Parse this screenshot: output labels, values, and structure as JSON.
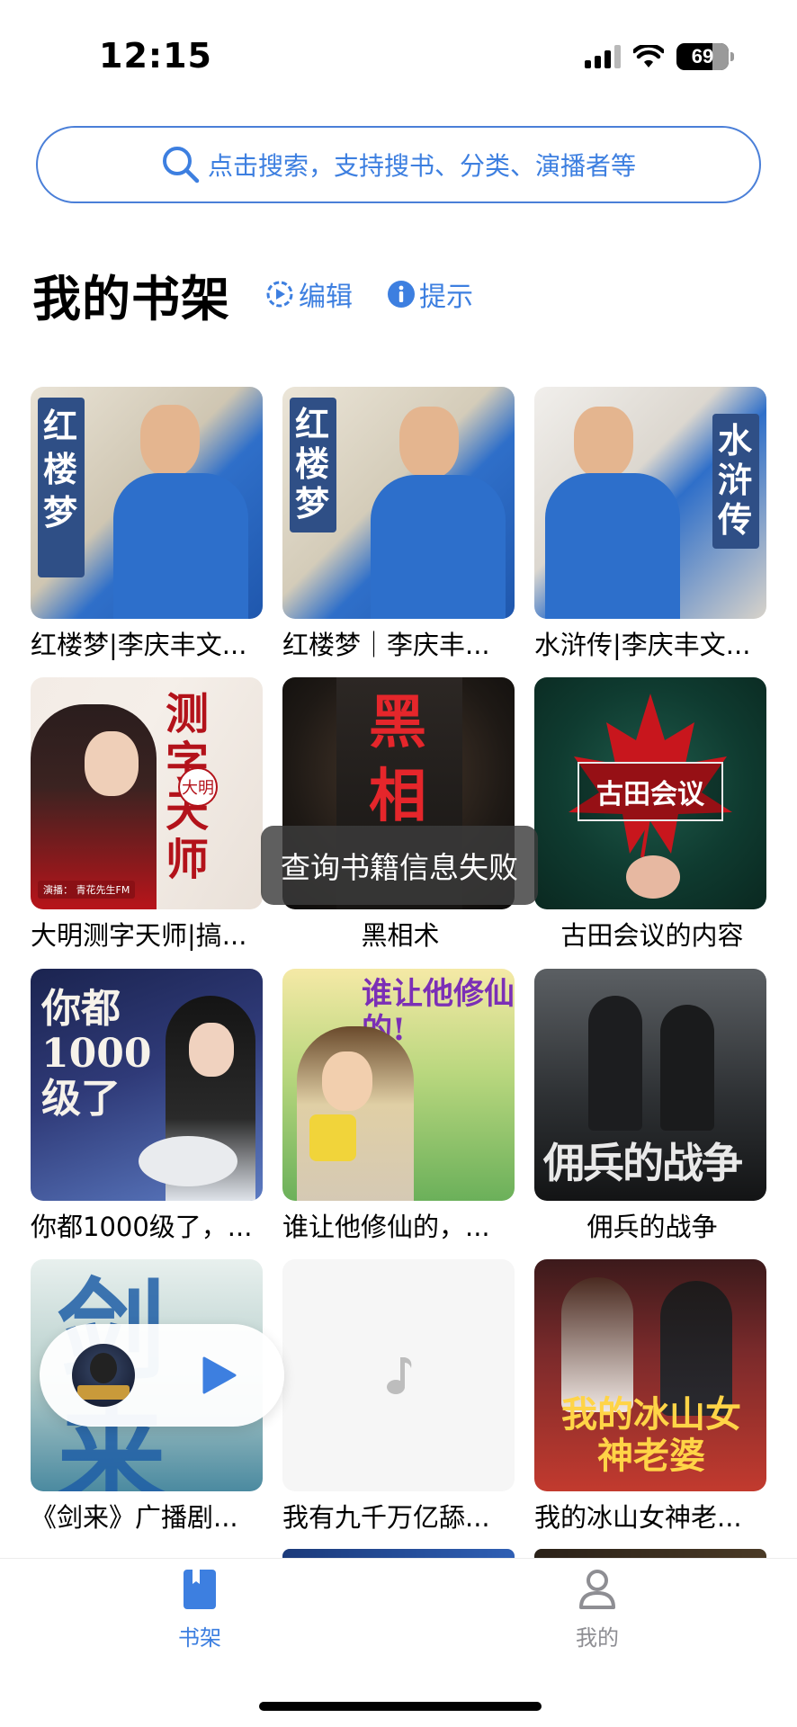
{
  "status_bar": {
    "time": "12:15",
    "battery": "69",
    "battery_level": 0.69
  },
  "search": {
    "placeholder": "点击搜索，支持搜书、分类、演播者等"
  },
  "shelf": {
    "title": "我的书架",
    "edit_label": "编辑",
    "tips_label": "提示"
  },
  "books": [
    {
      "title": "红楼梦|李庆丰文...",
      "cover_text": "红楼梦"
    },
    {
      "title": "红楼梦｜李庆丰...",
      "cover_text": "红楼梦"
    },
    {
      "title": "水浒传|李庆丰文...",
      "cover_text": "水浒传"
    },
    {
      "title": "大明测字天师|搞...",
      "cover_text": "测字天师",
      "cover_sub": "大明",
      "cover_credit": "演播：  青花先生FM"
    },
    {
      "title": "黑相术",
      "cover_text": "黑相"
    },
    {
      "title": "古田会议的内容",
      "cover_text": "古田会议"
    },
    {
      "title": "你都1000级了，...",
      "cover_text": "你都1000级了"
    },
    {
      "title": "谁让他修仙的，...",
      "cover_text": "谁让他修仙的!"
    },
    {
      "title": "佣兵的战争",
      "cover_text": "佣兵的战争"
    },
    {
      "title": "《剑来》广播剧...",
      "cover_text": "剑来"
    },
    {
      "title": "我有九千万亿舔...",
      "cover_text": ""
    },
    {
      "title": "我的冰山女神老...",
      "cover_text": "我的冰山女神老婆"
    }
  ],
  "toast": "查询书籍信息失败",
  "tabs": [
    {
      "label": "书架",
      "active": true
    },
    {
      "label": "我的",
      "active": false
    }
  ],
  "colors": {
    "accent": "#3d7fe0",
    "tab_inactive": "#8e8e93"
  }
}
